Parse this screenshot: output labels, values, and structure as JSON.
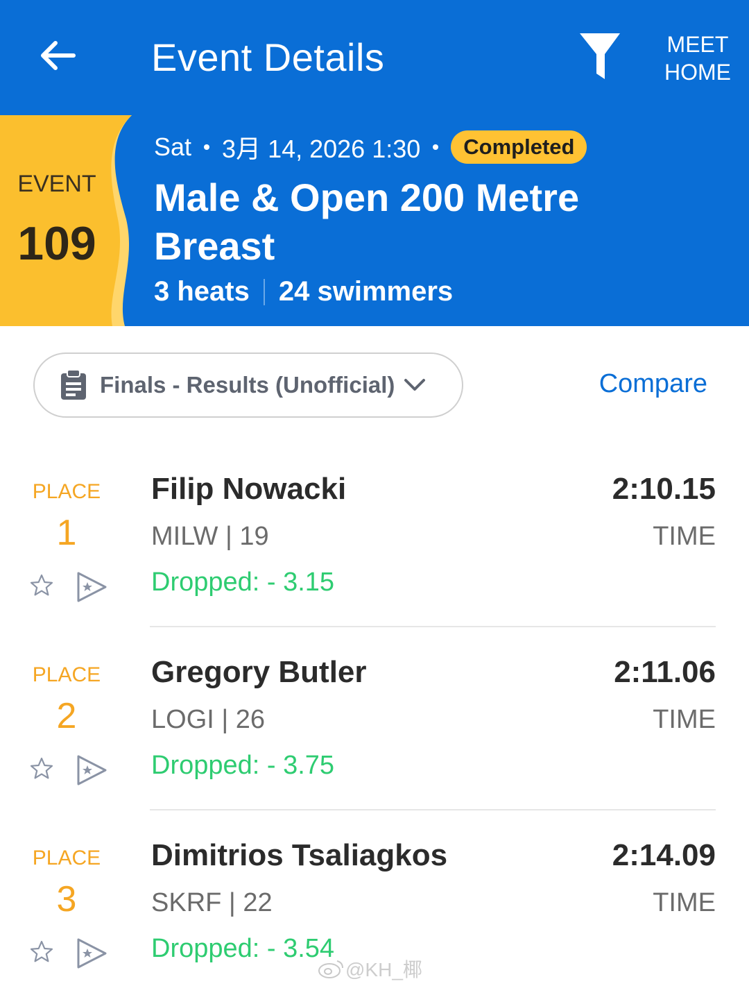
{
  "header": {
    "title": "Event Details",
    "meet_home_line1": "MEET",
    "meet_home_line2": "HOME",
    "back_icon": "arrow-left-icon",
    "filter_icon": "filter-icon"
  },
  "event": {
    "label": "EVENT",
    "number": "109",
    "day": "Sat",
    "datetime": "3月 14, 2026 1:30",
    "status": "Completed",
    "name": "Male & Open 200 Metre Breast",
    "heats": "3 heats",
    "swimmers": "24 swimmers"
  },
  "session": {
    "label": "Finals - Results (Unofficial)",
    "icon": "clipboard-icon"
  },
  "compare_label": "Compare",
  "results": [
    {
      "place_label": "PLACE",
      "place": "1",
      "name": "Filip Nowacki",
      "team_age": "MILW | 19",
      "dropped": "Dropped: - 3.15",
      "time": "2:10.15",
      "time_label": "TIME"
    },
    {
      "place_label": "PLACE",
      "place": "2",
      "name": "Gregory Butler",
      "team_age": "LOGI | 26",
      "dropped": "Dropped: - 3.75",
      "time": "2:11.06",
      "time_label": "TIME"
    },
    {
      "place_label": "PLACE",
      "place": "3",
      "name": "Dimitrios Tsaliagkos",
      "team_age": "SKRF | 22",
      "dropped": "Dropped: - 3.54",
      "time": "2:14.09",
      "time_label": "TIME"
    }
  ],
  "watermark": "@KH_椰",
  "colors": {
    "header_blue": "#0a6ed6",
    "accent_yellow": "#ffc233",
    "place_orange": "#f5a623",
    "dropped_green": "#2ecc71"
  }
}
